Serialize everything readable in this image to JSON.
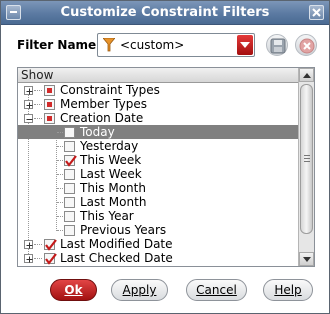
{
  "window": {
    "title": "Customize Constraint Filters"
  },
  "filter": {
    "label": "Filter Name:",
    "value": "<custom>"
  },
  "tree": {
    "column_header": "Show",
    "items": [
      {
        "label": "Constraint Types",
        "checked": "partial"
      },
      {
        "label": "Member Types",
        "checked": "partial"
      },
      {
        "label": "Creation Date",
        "checked": "partial"
      },
      {
        "label": "Today",
        "checked": "unchecked",
        "selected": true
      },
      {
        "label": "Yesterday",
        "checked": "unchecked"
      },
      {
        "label": "This Week",
        "checked": "checked"
      },
      {
        "label": "Last Week",
        "checked": "unchecked"
      },
      {
        "label": "This Month",
        "checked": "unchecked"
      },
      {
        "label": "Last Month",
        "checked": "unchecked"
      },
      {
        "label": "This Year",
        "checked": "unchecked"
      },
      {
        "label": "Previous Years",
        "checked": "unchecked"
      },
      {
        "label": "Last Modified Date",
        "checked": "checked"
      },
      {
        "label": "Last Checked Date",
        "checked": "checked"
      }
    ]
  },
  "buttons": {
    "ok": "Ok",
    "apply": "Apply",
    "cancel": "Cancel",
    "help": "Help"
  },
  "colors": {
    "accent": "#c41a1a",
    "titlebar": "#5b7aa2",
    "selection": "#808080"
  }
}
